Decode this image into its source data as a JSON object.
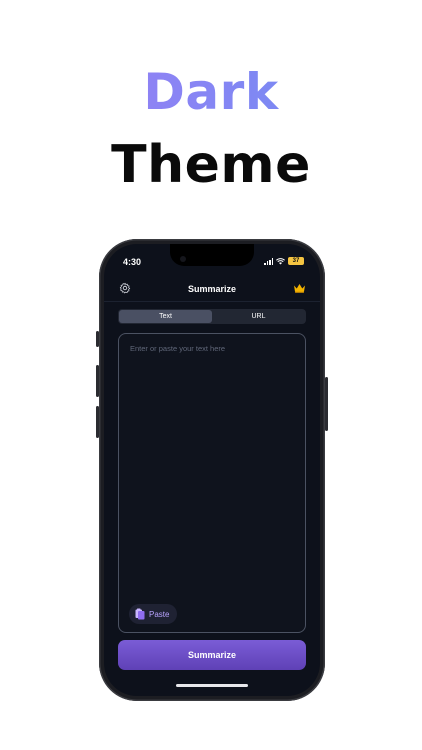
{
  "promo": {
    "headline_top": "Dark",
    "headline_bottom": "Theme"
  },
  "status_bar": {
    "time": "4:30",
    "battery": "37",
    "icons": [
      "signal-icon",
      "wifi-icon",
      "battery-icon"
    ]
  },
  "nav": {
    "title": "Summarize",
    "left_icon": "gear-icon",
    "right_icon": "crown-icon"
  },
  "segment": {
    "tabs": [
      {
        "label": "Text",
        "selected": true
      },
      {
        "label": "URL",
        "selected": false
      }
    ]
  },
  "editor": {
    "placeholder": "Enter or paste your text here",
    "value": ""
  },
  "paste_button": {
    "label": "Paste",
    "icon": "clipboard-icon"
  },
  "primary_action": {
    "label": "Summarize"
  },
  "colors": {
    "background": "#0d111b",
    "accent": "#6a4bc6",
    "headline_gradient_start": "#a07cf5",
    "headline_gradient_end": "#6b8ff2",
    "battery": "#f5c542"
  }
}
